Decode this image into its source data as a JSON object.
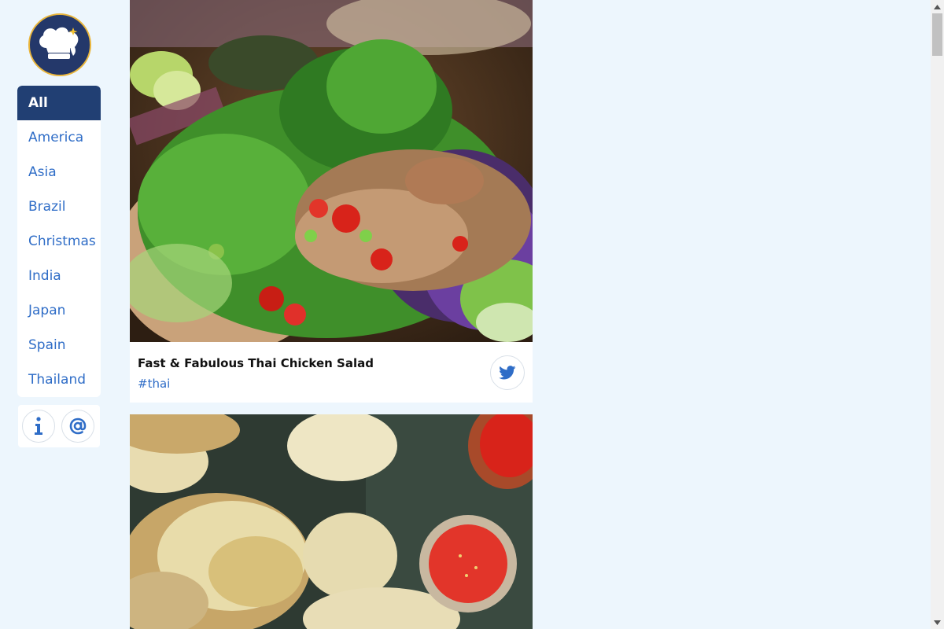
{
  "sidebar": {
    "logo": "chef-hat-logo",
    "categories": [
      {
        "label": "All",
        "active": true
      },
      {
        "label": "America",
        "active": false
      },
      {
        "label": "Asia",
        "active": false
      },
      {
        "label": "Brazil",
        "active": false
      },
      {
        "label": "Christmas",
        "active": false
      },
      {
        "label": "India",
        "active": false
      },
      {
        "label": "Japan",
        "active": false
      },
      {
        "label": "Spain",
        "active": false
      },
      {
        "label": "Thailand",
        "active": false
      }
    ],
    "info_button": "info-icon",
    "contact_button": "at-sign-icon"
  },
  "feed": {
    "cards": [
      {
        "title": "Fast & Fabulous Thai Chicken Salad",
        "tag": "#thai",
        "image": "thai-chicken-salad-photo",
        "share_icon": "twitter-icon"
      },
      {
        "image": "dumplings-photo"
      }
    ]
  },
  "colors": {
    "page_background": "#edf6fd",
    "active_nav": "#213f73",
    "link": "#2f6dc7",
    "logo_border": "#e9b53b"
  }
}
